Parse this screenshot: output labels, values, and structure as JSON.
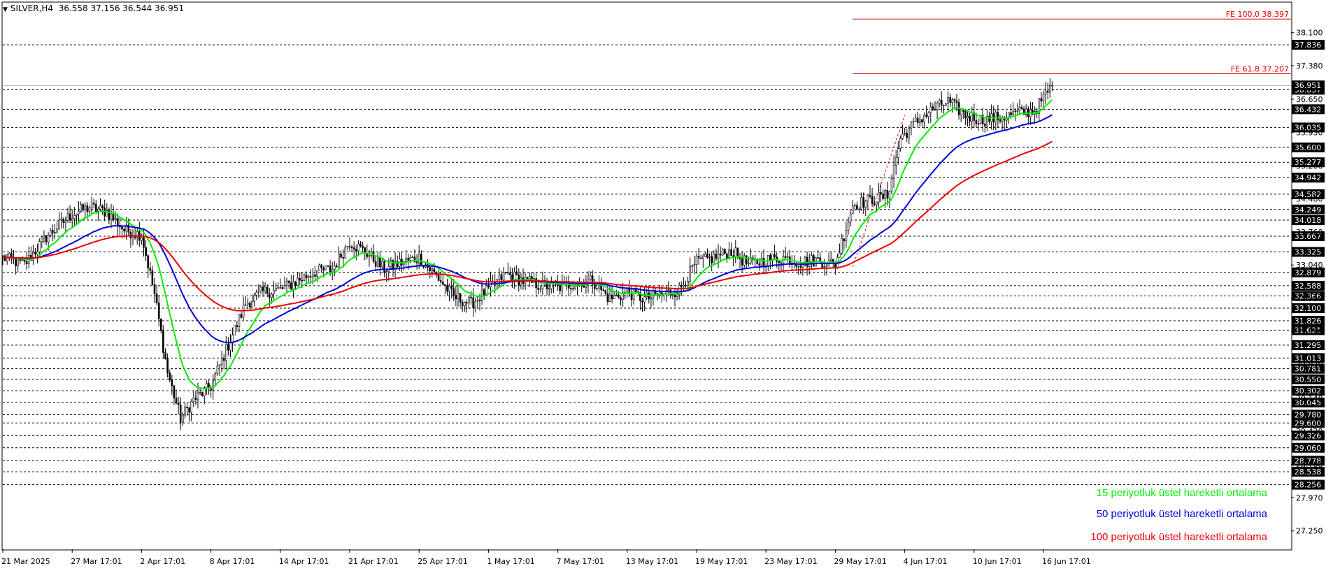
{
  "header": {
    "symbol": "SILVER,H4",
    "ohlc": "36.558 37.156 36.544 36.951"
  },
  "legend": {
    "ema15": "15 periyotluk üstel hareketli ortalama",
    "ema50": "50 periyotluk üstel hareketli ortalama",
    "ema100": "100 periyotluk üstel hareketli ortalama"
  },
  "colors": {
    "ema15": "#00ee00",
    "ema50": "#0000dd",
    "ema100": "#ee0000",
    "candles": "#000000",
    "fibo": "#dd0000",
    "levels": "#000000"
  },
  "chart_data": {
    "type": "line",
    "title": "",
    "xlabel": "",
    "ylabel": "",
    "ylim": [
      26.85,
      38.75
    ],
    "y_ticks": [
      "38.100",
      "37.380",
      "36.650",
      "35.930",
      "35.200",
      "34.480",
      "33.760",
      "33.040",
      "32.310",
      "31.590",
      "30.870",
      "30.140",
      "29.420",
      "28.700",
      "27.970",
      "27.250"
    ],
    "x_ticks": [
      "21 Mar 2025",
      "27 Mar 17:01",
      "2 Apr 17:01",
      "8 Apr 17:01",
      "14 Apr 17:01",
      "21 Apr 17:01",
      "25 Apr 17:01",
      "1 May 17:01",
      "7 May 17:01",
      "13 May 17:01",
      "19 May 17:01",
      "23 May 17:01",
      "29 May 17:01",
      "4 Jun 17:01",
      "10 Jun 17:01",
      "16 Jun 17:01"
    ],
    "x_tick_index": [
      0,
      32,
      64,
      96,
      128,
      160,
      192,
      224,
      256,
      288,
      320,
      352,
      384,
      416,
      448,
      480
    ],
    "current_price": 36.951,
    "levels": [
      37.836,
      36.857,
      36.432,
      36.035,
      35.6,
      35.277,
      34.942,
      34.582,
      34.249,
      34.018,
      33.667,
      33.325,
      32.879,
      32.588,
      32.366,
      32.1,
      31.826,
      31.621,
      31.295,
      31.013,
      30.781,
      30.55,
      30.302,
      30.045,
      29.78,
      29.6,
      29.326,
      29.06,
      28.778,
      28.538,
      28.256
    ],
    "fibo": [
      {
        "label": "FE 100.0 38.397",
        "value": 38.397
      },
      {
        "label": "FE 61.8 37.207",
        "value": 37.207
      }
    ],
    "fibo_start_index": 392,
    "anchor_index": [
      0,
      10,
      20,
      32,
      40,
      48,
      56,
      64,
      70,
      76,
      82,
      88,
      96,
      104,
      112,
      120,
      128,
      136,
      144,
      152,
      160,
      168,
      176,
      184,
      192,
      200,
      208,
      216,
      224,
      232,
      240,
      248,
      256,
      264,
      272,
      280,
      288,
      296,
      304,
      312,
      320,
      328,
      336,
      344,
      352,
      360,
      368,
      376,
      384,
      392,
      400,
      408,
      414,
      420,
      428,
      436,
      444,
      452,
      460,
      468,
      476,
      484
    ],
    "anchor_close": [
      33.2,
      33.05,
      33.65,
      34.15,
      34.3,
      34.2,
      33.8,
      33.7,
      32.4,
      30.7,
      29.7,
      30.1,
      30.4,
      31.3,
      32.2,
      32.45,
      32.5,
      32.7,
      32.9,
      32.95,
      33.55,
      33.3,
      32.95,
      33.1,
      33.2,
      32.8,
      32.35,
      32.2,
      32.5,
      32.85,
      32.7,
      32.6,
      32.55,
      32.65,
      32.7,
      32.3,
      32.45,
      32.3,
      32.4,
      32.5,
      33.1,
      33.2,
      33.35,
      33.05,
      33.15,
      33.2,
      33.1,
      33.15,
      33.05,
      34.35,
      34.45,
      34.55,
      35.8,
      36.1,
      36.4,
      36.6,
      36.3,
      36.2,
      36.25,
      36.35,
      36.4,
      36.95
    ],
    "series": [
      {
        "name": "15 periyotluk üstel hareketli ortalama",
        "period": 15
      },
      {
        "name": "50 periyotluk üstel hareketli ortalama",
        "period": 50
      },
      {
        "name": "100 periyotluk üstel hareketli ortalama",
        "period": 100
      }
    ],
    "ema_seed": 33.2,
    "bars": 485
  }
}
